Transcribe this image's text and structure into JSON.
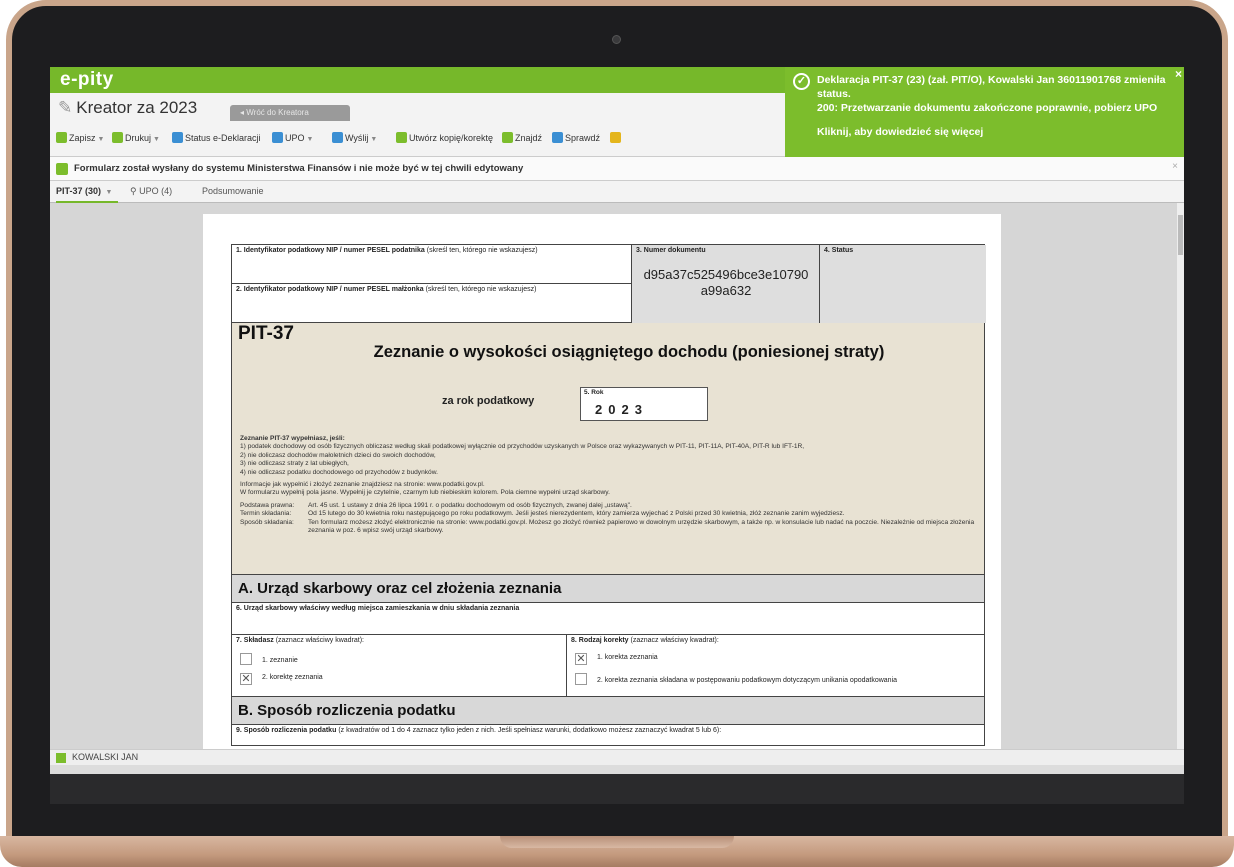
{
  "app": {
    "logo": "e-pity",
    "title": "Kreator za 2023",
    "back_tab": "Wróć do Kreatora"
  },
  "notification": {
    "line1": "Deklaracja PIT-37 (23) (zał. PIT/O), Kowalski Jan 36011901768 zmieniła status.",
    "line2": "200: Przetwarzanie dokumentu zakończone poprawnie, pobierz UPO",
    "line3": "Kliknij, aby dowiedzieć się więcej",
    "close": "×"
  },
  "toolbar": {
    "save": "Zapisz",
    "print": "Drukuj",
    "status": "Status e-Deklaracji",
    "upo": "UPO",
    "send": "Wyślij",
    "copy_correction": "Utwórz kopię/korektę",
    "find": "Znajdź",
    "check": "Sprawdź"
  },
  "infobar": {
    "text": "Formularz został wysłany do systemu Ministerstwa Finansów i nie może być w tej chwili edytowany",
    "close": "×"
  },
  "tabs": [
    {
      "label": "PIT-37 (30)"
    },
    {
      "label": "UPO (4)"
    },
    {
      "label": "Podsumowanie"
    }
  ],
  "status_bar": {
    "user": "KOWALSKI JAN"
  },
  "form": {
    "field1_label": "1. Identyfikator podatkowy NIP / numer PESEL podatnika",
    "field1_hint": "(skreśl ten, którego nie wskazujesz)",
    "field2_label": "2. Identyfikator podatkowy NIP / numer PESEL małżonka",
    "field2_hint": "(skreśl ten, którego nie wskazujesz)",
    "field3_label": "3. Numer dokumentu",
    "doc_number_1": "d95a37c525496bce3e10790",
    "doc_number_2": "a99a632",
    "field4_label": "4. Status",
    "code": "PIT-37",
    "title": "Zeznanie o wysokości osiągniętego dochodu (poniesionej straty)",
    "year_prefix": "za rok podatkowy",
    "year_label": "5. Rok",
    "year_value": "2023",
    "instr_head": "Zeznanie PIT-37 wypełniasz, jeśli:",
    "instr_1": "1) podatek dochodowy od osób fizycznych obliczasz według skali podatkowej wyłącznie od przychodów uzyskanych w Polsce oraz wykazywanych w PIT-11, PIT-11A, PIT-40A, PIT-R lub IFT-1R,",
    "instr_2": "2) nie doliczasz dochodów małoletnich dzieci do swoich dochodów,",
    "instr_3": "3) nie odliczasz straty z lat ubiegłych,",
    "instr_4": "4) nie odliczasz podatku dochodowego od przychodów z budynków.",
    "instr_5": "Informacje jak wypełnić i złożyć zeznanie znajdziesz na stronie: www.podatki.gov.pl.",
    "instr_6": "W formularzu wypełnij pola jasne. Wypełnij je czytelnie, czarnym lub niebieskim kolorem. Pola ciemne wypełni urząd skarbowy.",
    "legal_basis_key": "Podstawa prawna:",
    "legal_basis_val": "Art. 45 ust. 1 ustawy z dnia 26 lipca 1991 r. o podatku dochodowym od osób fizycznych, zwanej dalej „ustawą\".",
    "deadline_key": "Termin składania:",
    "deadline_val": "Od 15 lutego do 30 kwietnia roku następującego po roku podatkowym. Jeśli jesteś nierezydentem, który zamierza wyjechać z Polski przed 30 kwietnia, złóż zeznanie zanim wyjedziesz.",
    "method_key": "Sposób składania:",
    "method_val": "Ten formularz możesz złożyć elektronicznie na stronie: www.podatki.gov.pl. Możesz go złożyć również papierowo w dowolnym urzędzie skarbowym, a także np. w konsulacie lub nadać na poczcie. Niezależnie od miejsca złożenia zeznania w poz. 6 wpisz swój urząd skarbowy.",
    "section_a": "A. Urząd skarbowy oraz cel złożenia zeznania",
    "field6_label": "6. Urząd skarbowy właściwy według miejsca zamieszkania w dniu składania zeznania",
    "field7_label": "7. Składasz",
    "field7_hint": "(zaznacz właściwy kwadrat):",
    "opt7_1": "1. zeznanie",
    "opt7_2": "2. korektę zeznania",
    "field8_label": "8. Rodzaj korekty",
    "field8_hint": "(zaznacz właściwy kwadrat):",
    "opt8_1": "1. korekta zeznania",
    "opt8_2": "2. korekta zeznania składana w postępowaniu podatkowym dotyczącym unikania opodatkowania",
    "section_b": "B. Sposób rozliczenia podatku",
    "field9_label": "9. Sposób rozliczenia podatku",
    "field9_hint": "(z kwadratów od 1 do 4 zaznacz tylko jeden z nich. Jeśli spełniasz warunki, dodatkowo możesz zaznaczyć kwadrat 5 lub 6):"
  },
  "colors": {
    "brand_green": "#76b82a",
    "notification_green": "#7cbd2c",
    "form_beige": "#e8e2d3"
  }
}
